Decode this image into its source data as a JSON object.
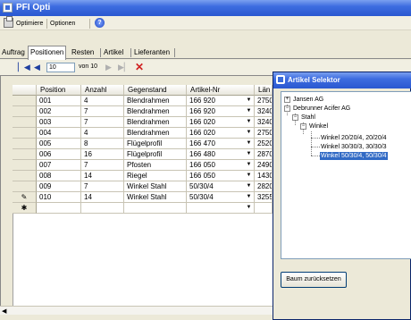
{
  "window": {
    "title": "PFI Opti"
  },
  "toolbar": {
    "optimize_label": "Optimiere",
    "options_label": "Optionen"
  },
  "tabs": [
    {
      "label": "Auftrag"
    },
    {
      "label": "Positionen",
      "active": true
    },
    {
      "label": "Resten"
    },
    {
      "label": "Artikel"
    },
    {
      "label": "Lieferanten"
    }
  ],
  "navigator": {
    "current": "10",
    "of_label": "von 10",
    "first": "▏◀",
    "prev": "◀",
    "next": "▶",
    "last": "▶▏",
    "delete": "✕"
  },
  "grid": {
    "columns": [
      "Position",
      "Anzahl",
      "Gegenstand",
      "Artikel-Nr",
      "Län"
    ],
    "rows": [
      {
        "position": "001",
        "anzahl": "4",
        "gegenstand": "Blendrahmen",
        "artikel": "166 920",
        "laenge": "2750"
      },
      {
        "position": "002",
        "anzahl": "7",
        "gegenstand": "Blendrahmen",
        "artikel": "166 920",
        "laenge": "3240"
      },
      {
        "position": "003",
        "anzahl": "7",
        "gegenstand": "Blendrahmen",
        "artikel": "166 020",
        "laenge": "3240"
      },
      {
        "position": "004",
        "anzahl": "4",
        "gegenstand": "Blendrahmen",
        "artikel": "166 020",
        "laenge": "2750"
      },
      {
        "position": "005",
        "anzahl": "8",
        "gegenstand": "Flügelprofil",
        "artikel": "166 470",
        "laenge": "2520"
      },
      {
        "position": "006",
        "anzahl": "16",
        "gegenstand": "Flügelprofil",
        "artikel": "166 480",
        "laenge": "2870"
      },
      {
        "position": "007",
        "anzahl": "7",
        "gegenstand": "Pfosten",
        "artikel": "166 050",
        "laenge": "2490"
      },
      {
        "position": "008",
        "anzahl": "14",
        "gegenstand": "Riegel",
        "artikel": "166 050",
        "laenge": "1430"
      },
      {
        "position": "009",
        "anzahl": "7",
        "gegenstand": "Winkel Stahl",
        "artikel": "50/30/4",
        "laenge": "2820"
      },
      {
        "position": "010",
        "anzahl": "14",
        "gegenstand": "Winkel Stahl",
        "artikel": "50/30/4",
        "laenge": "3255"
      }
    ],
    "edit_marker": "✎",
    "new_marker": "✱"
  },
  "selector": {
    "title": "Artikel Selektor",
    "tree": [
      {
        "label": "Jansen AG",
        "expander": "+"
      },
      {
        "label": "Debrunner Acifer AG",
        "expander": "−"
      },
      {
        "label": "Stahl",
        "expander": "−"
      },
      {
        "label": "Winkel",
        "expander": "−"
      },
      {
        "label": "Winkel 20/20/4, 20/20/4"
      },
      {
        "label": "Winkel 30/30/3, 30/30/3"
      },
      {
        "label": "Winkel 50/30/4, 50/30/4",
        "selected": true
      }
    ],
    "reset_label": "Baum zurücksetzen"
  }
}
